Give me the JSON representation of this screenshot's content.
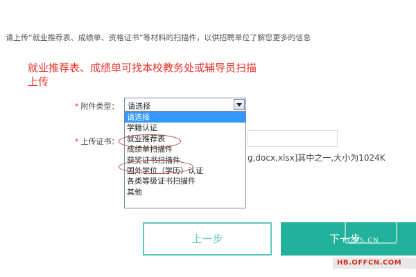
{
  "intro_text": "请上传“就业推荐表、成绩单、资格证书”等材料的扫描件，以供招聘单位了解您更多的信息",
  "notice_text": "就业推荐表、成绩单可找本校教务处或辅导员扫描上传",
  "fields": {
    "required_mark": "*",
    "attachment_type_label": "附件类型：",
    "attachment_type_selected": "请选择",
    "upload_cert_label": "上传证书：",
    "format_hint": "g,docx,xlsx]其中之一,大小为1024K"
  },
  "dropdown": {
    "options": [
      "请选择",
      "学籍认证",
      "就业推荐表",
      "成绩单扫描件",
      "获奖证书扫描件",
      "国外学位（学历）认证",
      "各类等级证书扫描件",
      "其他"
    ],
    "selected_index": 0
  },
  "buttons": {
    "prev_label": "上一步",
    "next_label": "下一步"
  },
  "watermark": {
    "text1": "PCMS.CN",
    "text2": "HB.OFFCN.COM"
  },
  "colors": {
    "notice": "#e5332a",
    "primary": "#22b29c",
    "outline": "#5bc9b8",
    "highlight": "#3399ff",
    "annotation": "#a23a3a"
  }
}
